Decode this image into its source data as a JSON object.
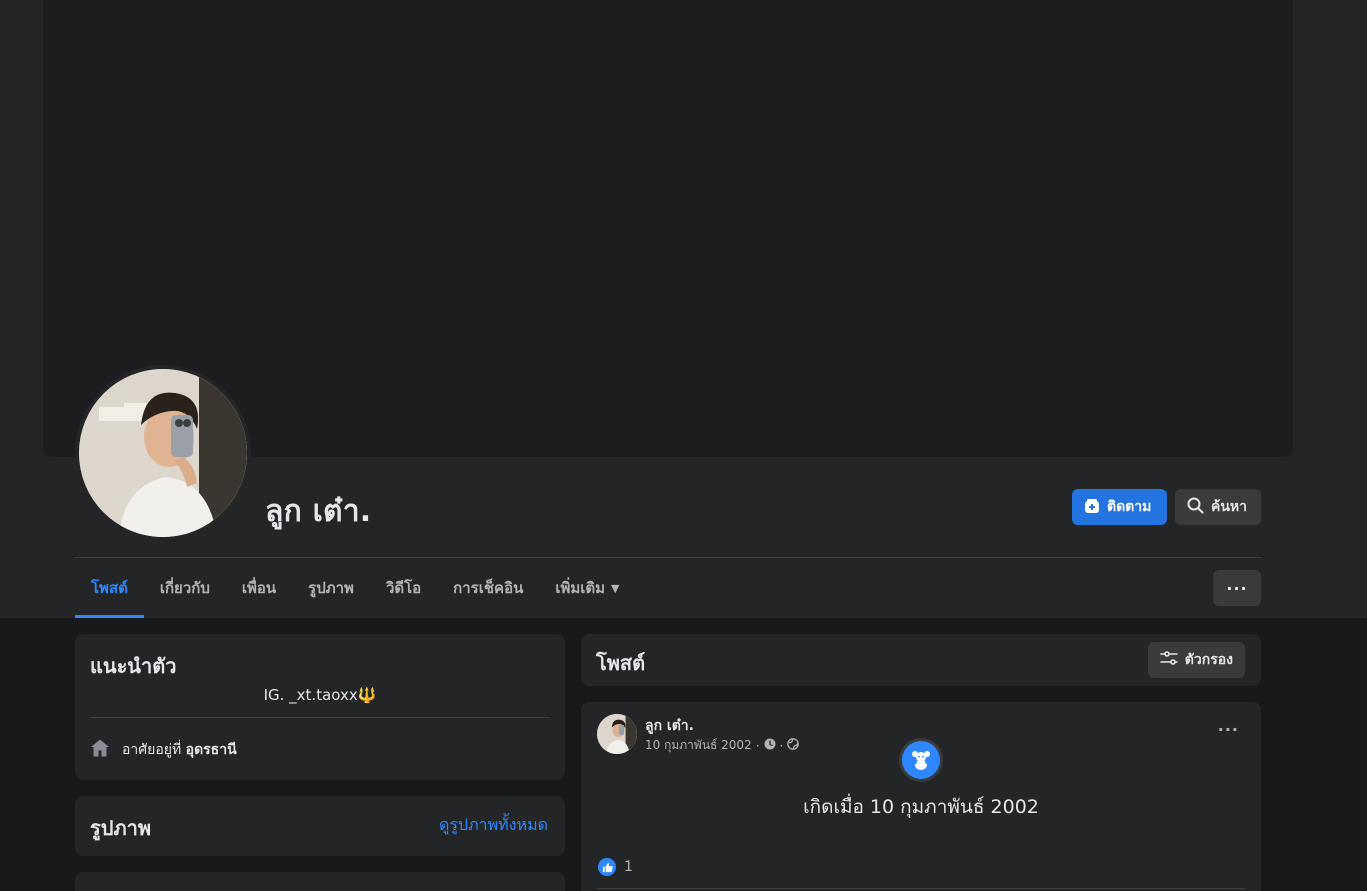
{
  "profile": {
    "name": "ลูก เต๋า.",
    "follow_label": "ติดตาม",
    "search_label": "ค้นหา",
    "more_label": "···"
  },
  "tabs": [
    {
      "label": "โพสต์",
      "active": true
    },
    {
      "label": "เกี่ยวกับ"
    },
    {
      "label": "เพื่อน"
    },
    {
      "label": "รูปภาพ"
    },
    {
      "label": "วิดีโอ"
    },
    {
      "label": "การเช็คอิน"
    },
    {
      "label": "เพิ่มเติม",
      "caret": "▼"
    }
  ],
  "intro": {
    "title": "แนะนำตัว",
    "bio": "IG. _xt.taoxx",
    "bio_emoji": "🔱",
    "lives_in_label": "อาศัยอยู่ที่",
    "lives_in_value": "อุดรธานี"
  },
  "photos": {
    "title": "รูปภาพ",
    "see_all": "ดูรูปภาพทั้งหมด"
  },
  "posts": {
    "title": "โพสต์",
    "filter_label": "ตัวกรอง"
  },
  "post": {
    "author": "ลูก เต๋า.",
    "date": "10 กุมภาพันธ์ 2002",
    "meta_sep": "·",
    "life_event": "เกิดเมื่อ 10 กุมภาพันธ์ 2002",
    "like_count": "1",
    "dots": "···"
  },
  "colors": {
    "accent": "#2d88ff",
    "button_primary": "#2374e1",
    "card": "#242526",
    "background": "#18191a"
  },
  "icons": {
    "follow": "add-friend-icon",
    "search": "search-icon",
    "home": "home-icon",
    "filter": "filter-sliders-icon",
    "clock": "clock-icon",
    "globe": "globe-icon",
    "life_event": "teddy-bear-icon",
    "like": "thumbs-up-icon"
  }
}
